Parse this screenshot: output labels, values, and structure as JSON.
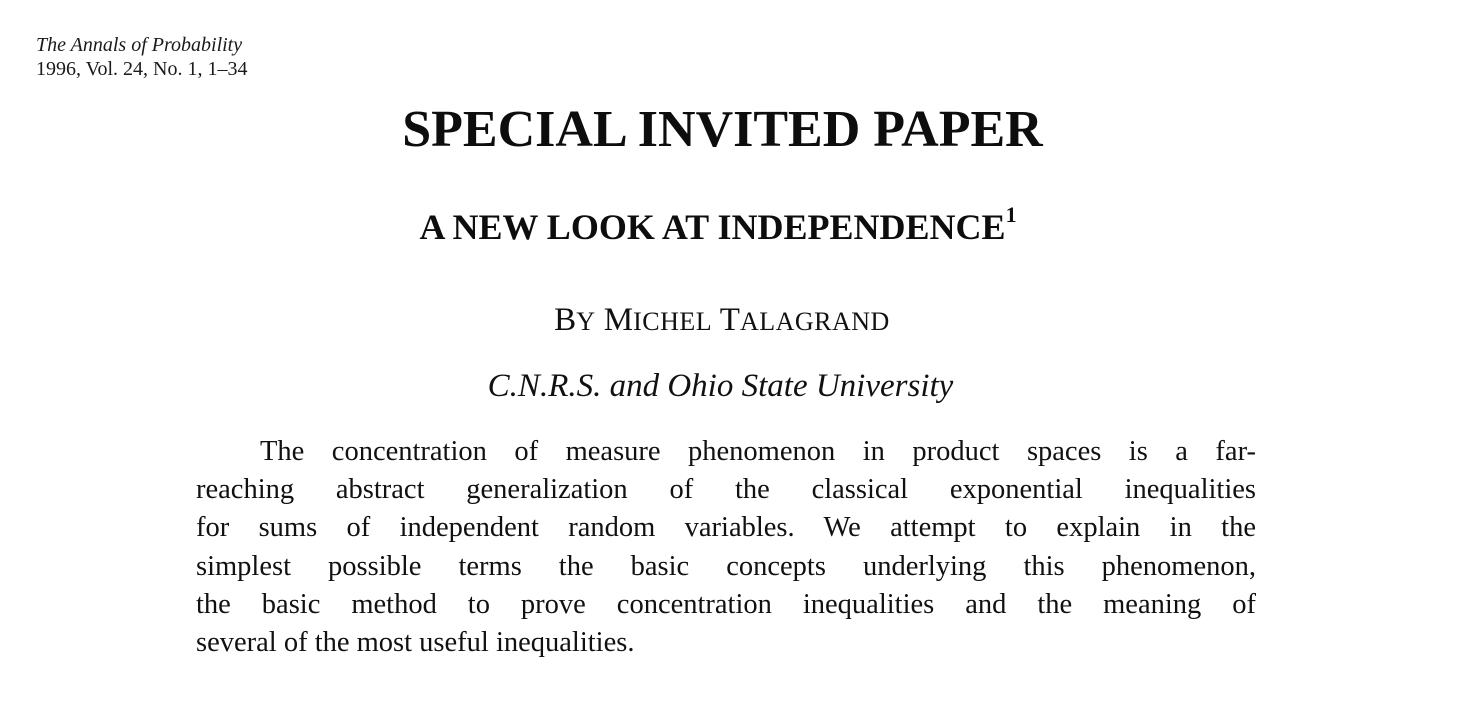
{
  "journal": {
    "name": "The Annals of Probability",
    "citation": "1996, Vol. 24, No. 1, 1–34"
  },
  "header": {
    "section": "SPECIAL INVITED PAPER"
  },
  "paper": {
    "title": "A NEW LOOK AT INDEPENDENCE",
    "footnote_mark": "1",
    "author_prefix_initial": "B",
    "author_prefix_rest": "Y",
    "author_first_initial": "M",
    "author_first_rest": "ICHEL",
    "author_last_initial": "T",
    "author_last_rest": "ALAGRAND",
    "affiliation": "C.N.R.S. and Ohio State University"
  },
  "abstract": {
    "lines": [
      "The concentration of measure phenomenon in product spaces is a far-",
      "reaching abstract generalization of the classical exponential inequalities",
      "for sums of independent random variables. We attempt to explain in the",
      "simplest possible terms the basic concepts underlying this phenomenon,",
      "the basic method to prove concentration inequalities and the meaning of",
      "several of the most useful inequalities."
    ]
  }
}
